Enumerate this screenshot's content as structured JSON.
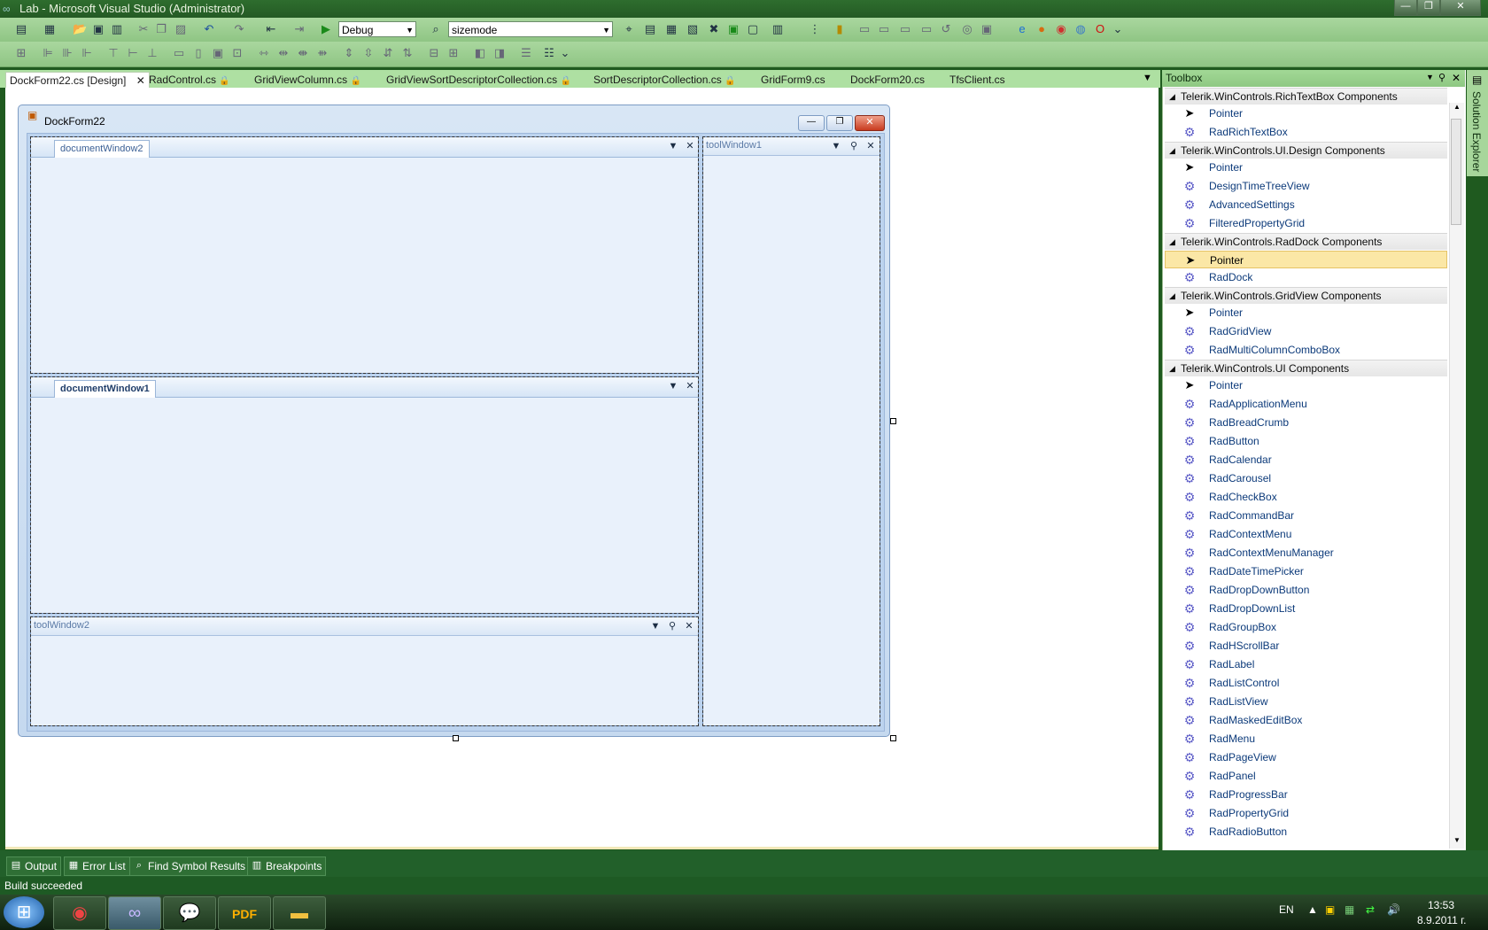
{
  "window": {
    "title": "Lab - Microsoft Visual Studio (Administrator)"
  },
  "toolbar": {
    "configuration": "Debug",
    "find_text": "sizemode"
  },
  "tabs": [
    {
      "label": "DockForm22.cs [Design]"
    },
    {
      "label": "RadControl.cs"
    },
    {
      "label": "GridViewColumn.cs"
    },
    {
      "label": "GridViewSortDescriptorCollection.cs"
    },
    {
      "label": "SortDescriptorCollection.cs"
    },
    {
      "label": "GridForm9.cs"
    },
    {
      "label": "DockForm20.cs"
    },
    {
      "label": "TfsClient.cs"
    }
  ],
  "designer": {
    "form_title": "DockForm22",
    "document_window2": "documentWindow2",
    "document_window1": "documentWindow1",
    "tool_window1": "toolWindow1",
    "tool_window2": "toolWindow2"
  },
  "toolbox": {
    "title": "Toolbox",
    "groups": [
      {
        "name": "Telerik.WinControls.RichTextBox Components",
        "items": [
          "Pointer",
          "RadRichTextBox"
        ]
      },
      {
        "name": "Telerik.WinControls.UI.Design Components",
        "items": [
          "Pointer",
          "DesignTimeTreeView",
          "AdvancedSettings",
          "FilteredPropertyGrid"
        ]
      },
      {
        "name": "Telerik.WinControls.RadDock Components",
        "items": [
          "Pointer",
          "RadDock"
        ]
      },
      {
        "name": "Telerik.WinControls.GridView Components",
        "items": [
          "Pointer",
          "RadGridView",
          "RadMultiColumnComboBox"
        ]
      },
      {
        "name": "Telerik.WinControls.UI Components",
        "items": [
          "Pointer",
          "RadApplicationMenu",
          "RadBreadCrumb",
          "RadButton",
          "RadCalendar",
          "RadCarousel",
          "RadCheckBox",
          "RadCommandBar",
          "RadContextMenu",
          "RadContextMenuManager",
          "RadDateTimePicker",
          "RadDropDownButton",
          "RadDropDownList",
          "RadGroupBox",
          "RadHScrollBar",
          "RadLabel",
          "RadListControl",
          "RadListView",
          "RadMaskedEditBox",
          "RadMenu",
          "RadPageView",
          "RadPanel",
          "RadProgressBar",
          "RadPropertyGrid",
          "RadRadioButton"
        ]
      }
    ]
  },
  "side_panel": {
    "solution_explorer": "Solution Explorer"
  },
  "bottom_tabs": [
    "Output",
    "Error List",
    "Find Symbol Results",
    "Breakpoints"
  ],
  "status": "Build succeeded",
  "tray": {
    "language": "EN",
    "time": "13:53",
    "date": "8.9.2011 г."
  }
}
